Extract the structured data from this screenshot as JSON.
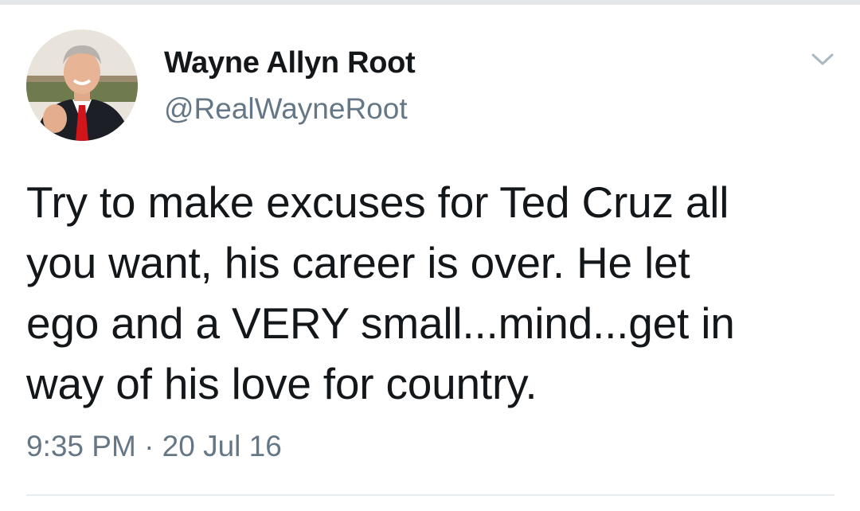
{
  "tweet": {
    "author": {
      "display_name": "Wayne Allyn Root",
      "handle": "@RealWayneRoot",
      "avatar_icon": "profile-photo"
    },
    "text": "Try to make excuses for Ted Cruz all\nyou want, his career is over. He let\nego and a VERY small...mind...get in\nway of his love for country.",
    "timestamp": "9:35 PM · 20 Jul 16",
    "menu_icon": "chevron-down-icon"
  },
  "colors": {
    "text_primary": "#14171a",
    "text_secondary": "#657786",
    "divider": "#e6ecf0"
  }
}
